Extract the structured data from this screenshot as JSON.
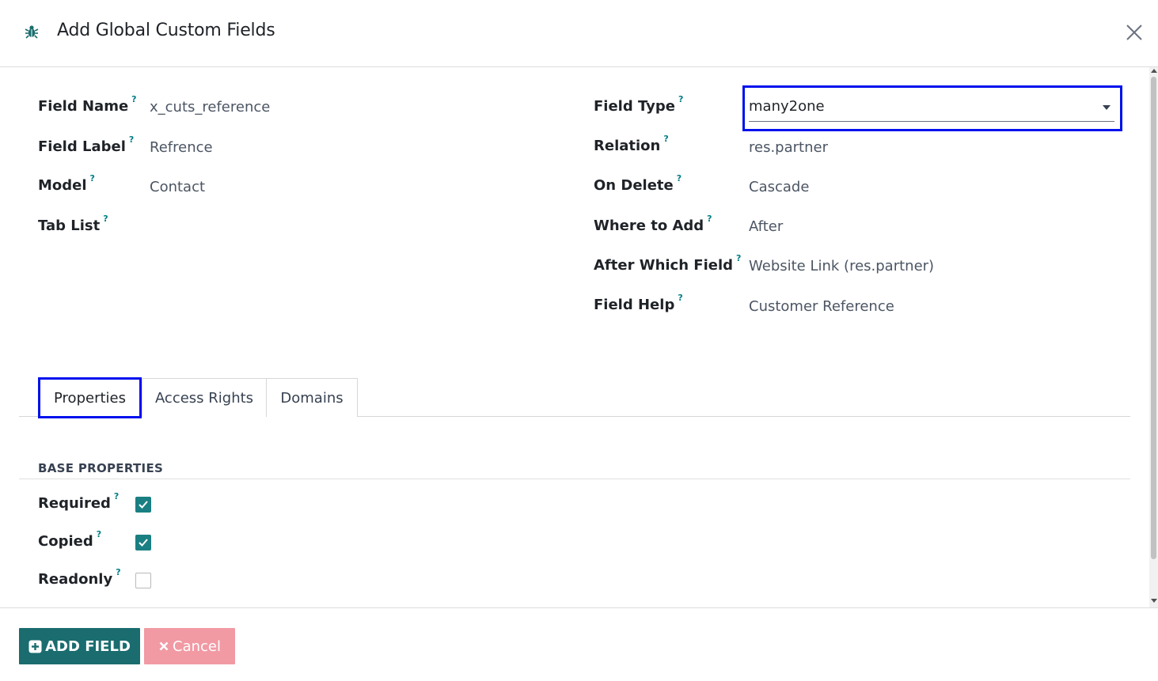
{
  "dialog": {
    "title": "Add Global Custom Fields",
    "help_marker": "?"
  },
  "left_fields": [
    {
      "label": "Field Name",
      "value": "x_cuts_reference"
    },
    {
      "label": "Field Label",
      "value": "Refrence"
    },
    {
      "label": "Model",
      "value": "Contact"
    },
    {
      "label": "Tab List",
      "value": ""
    }
  ],
  "right_fields": [
    {
      "label": "Field Type",
      "value": "many2one"
    },
    {
      "label": "Relation",
      "value": "res.partner"
    },
    {
      "label": "On Delete",
      "value": "Cascade"
    },
    {
      "label": "Where to Add",
      "value": "After"
    },
    {
      "label": "After Which Field",
      "value": "Website Link (res.partner)"
    },
    {
      "label": "Field Help",
      "value": "Customer Reference"
    }
  ],
  "tabs": [
    {
      "label": "Properties",
      "active": true
    },
    {
      "label": "Access Rights",
      "active": false
    },
    {
      "label": "Domains",
      "active": false
    }
  ],
  "base_properties": {
    "title": "BASE PROPERTIES",
    "items": [
      {
        "label": "Required",
        "checked": true
      },
      {
        "label": "Copied",
        "checked": true
      },
      {
        "label": "Readonly",
        "checked": false
      }
    ]
  },
  "footer": {
    "add_label": "ADD FIELD",
    "cancel_label": "Cancel"
  },
  "colors": {
    "primary": "#1a6c6f",
    "checkbox": "#1a7f82",
    "highlight_border": "#0011ee",
    "cancel": "#f19aa4",
    "help_marker": "#017e84"
  }
}
